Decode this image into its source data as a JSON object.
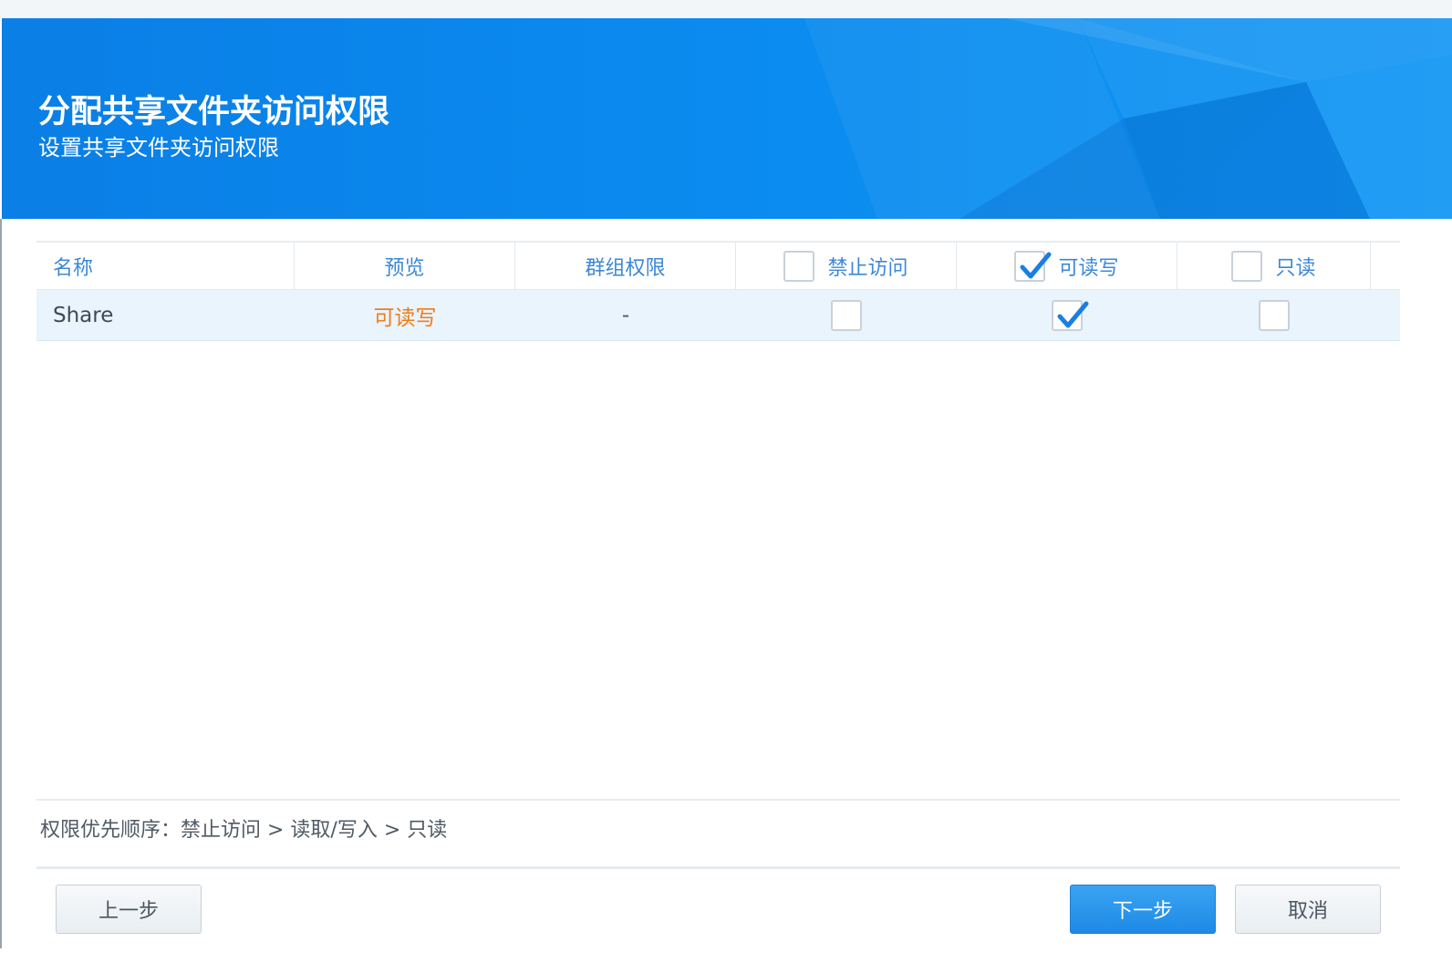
{
  "header": {
    "title": "分配共享文件夹访问权限",
    "subtitle": "设置共享文件夹访问权限"
  },
  "table": {
    "columns": {
      "name": "名称",
      "preview": "预览",
      "group_permission": "群组权限",
      "deny": "禁止访问",
      "read_write": "可读写",
      "read_only": "只读"
    },
    "header_checks": {
      "deny": false,
      "read_write": true,
      "read_only": false
    },
    "rows": [
      {
        "name": "Share",
        "preview": "可读写",
        "group_permission": "-",
        "deny": false,
        "read_write": true,
        "read_only": false
      }
    ]
  },
  "footer": {
    "priority_text": "权限优先顺序：禁止访问 > 读取/写入 > 只读",
    "prev_label": "上一步",
    "next_label": "下一步",
    "cancel_label": "取消"
  },
  "colors": {
    "header_blue": "#0b8cf0",
    "link_blue": "#3c88d8",
    "preview_orange": "#f07d1a",
    "row_highlight": "#e9f4fd",
    "check_blue": "#1a7fe0"
  }
}
